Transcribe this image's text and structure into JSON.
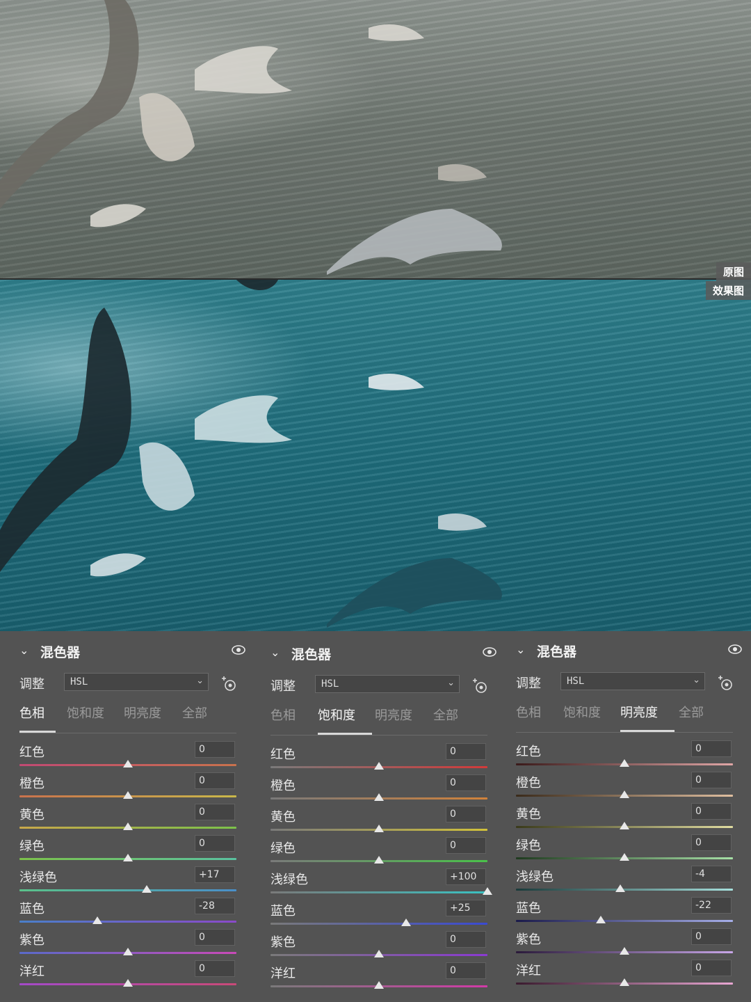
{
  "labels": {
    "original": "原图",
    "edited": "效果图"
  },
  "panels": [
    {
      "title": "混色器",
      "adjust_label": "调整",
      "mode": "HSL",
      "tabs": [
        "色相",
        "饱和度",
        "明亮度",
        "全部"
      ],
      "active_tab": 0,
      "rows": [
        {
          "label": "红色",
          "value": "0",
          "level": 0
        },
        {
          "label": "橙色",
          "value": "0",
          "level": 0
        },
        {
          "label": "黄色",
          "value": "0",
          "level": 0
        },
        {
          "label": "绿色",
          "value": "0",
          "level": 0
        },
        {
          "label": "浅绿色",
          "value": "+17",
          "level": 17
        },
        {
          "label": "蓝色",
          "value": "-28",
          "level": -28
        },
        {
          "label": "紫色",
          "value": "0",
          "level": 0
        },
        {
          "label": "洋红",
          "value": "0",
          "level": 0
        }
      ]
    },
    {
      "title": "混色器",
      "adjust_label": "调整",
      "mode": "HSL",
      "tabs": [
        "色相",
        "饱和度",
        "明亮度",
        "全部"
      ],
      "active_tab": 1,
      "rows": [
        {
          "label": "红色",
          "value": "0",
          "level": 0
        },
        {
          "label": "橙色",
          "value": "0",
          "level": 0
        },
        {
          "label": "黄色",
          "value": "0",
          "level": 0
        },
        {
          "label": "绿色",
          "value": "0",
          "level": 0
        },
        {
          "label": "浅绿色",
          "value": "+100",
          "level": 100
        },
        {
          "label": "蓝色",
          "value": "+25",
          "level": 25
        },
        {
          "label": "紫色",
          "value": "0",
          "level": 0
        },
        {
          "label": "洋红",
          "value": "0",
          "level": 0
        }
      ]
    },
    {
      "title": "混色器",
      "adjust_label": "调整",
      "mode": "HSL",
      "tabs": [
        "色相",
        "饱和度",
        "明亮度",
        "全部"
      ],
      "active_tab": 2,
      "rows": [
        {
          "label": "红色",
          "value": "0",
          "level": 0
        },
        {
          "label": "橙色",
          "value": "0",
          "level": 0
        },
        {
          "label": "黄色",
          "value": "0",
          "level": 0
        },
        {
          "label": "绿色",
          "value": "0",
          "level": 0
        },
        {
          "label": "浅绿色",
          "value": "-4",
          "level": -4
        },
        {
          "label": "蓝色",
          "value": "-22",
          "level": -22
        },
        {
          "label": "紫色",
          "value": "0",
          "level": 0
        },
        {
          "label": "洋红",
          "value": "0",
          "level": 0
        }
      ]
    }
  ],
  "track_gradients": {
    "hue": [
      [
        "#c14a73",
        "#c9724d"
      ],
      [
        "#c9724d",
        "#c9b84a"
      ],
      [
        "#c9a84a",
        "#7cc24a"
      ],
      [
        "#7cc24a",
        "#5ac2a0"
      ],
      [
        "#5ac28a",
        "#4a8fc9"
      ],
      [
        "#4a7fc9",
        "#8a4ac9"
      ],
      [
        "#5a6ac9",
        "#c94ab8"
      ],
      [
        "#a44ac9",
        "#c94a78"
      ]
    ],
    "saturation": [
      [
        "#7a7a7a",
        "#d23a3a"
      ],
      [
        "#7a7a7a",
        "#d2823a"
      ],
      [
        "#7a7a7a",
        "#d2c23a"
      ],
      [
        "#7a7a7a",
        "#4ac24a"
      ],
      [
        "#7a7a7a",
        "#3ac2c2"
      ],
      [
        "#7a7a7a",
        "#3a4ad2"
      ],
      [
        "#7a7a7a",
        "#8a3ad2"
      ],
      [
        "#7a7a7a",
        "#d23aa8"
      ]
    ],
    "luminance": [
      [
        "#3a1a1a",
        "#e0a6a6"
      ],
      [
        "#3a2a1a",
        "#e0bfa0"
      ],
      [
        "#3a3a1a",
        "#e0dca0"
      ],
      [
        "#1f3a1f",
        "#a6e0a6"
      ],
      [
        "#1a3a3a",
        "#a6e0dc"
      ],
      [
        "#1a1a4a",
        "#a6aee8"
      ],
      [
        "#2a1a3a",
        "#c8a6e8"
      ],
      [
        "#3a1a2e",
        "#e8a6d2"
      ]
    ]
  }
}
